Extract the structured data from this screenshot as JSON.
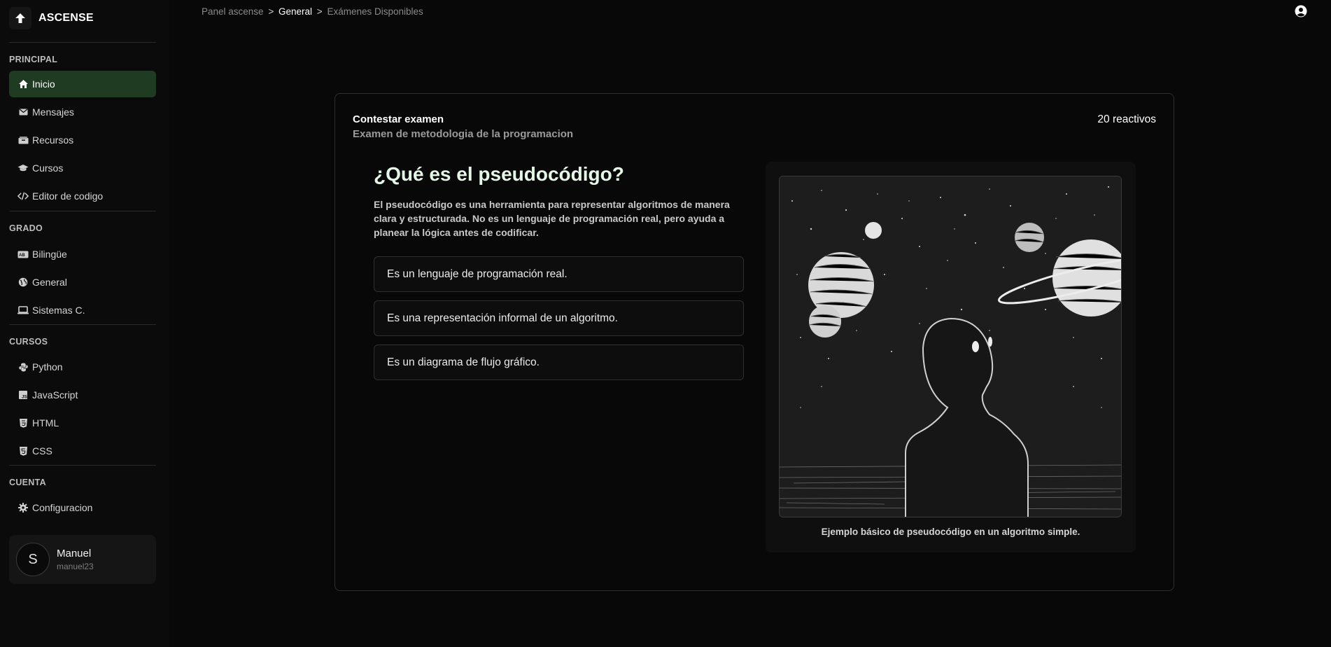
{
  "brand": {
    "name": "ASCENSE"
  },
  "sidebar": {
    "sections": {
      "principal": "PRINCIPAL",
      "grado": "GRADO",
      "cursos": "CURSOS",
      "cuenta": "CUENTA"
    },
    "principal_items": [
      {
        "label": "Inicio",
        "icon": "home-icon",
        "active": true
      },
      {
        "label": "Mensajes",
        "icon": "envelope-icon"
      },
      {
        "label": "Recursos",
        "icon": "box-icon"
      },
      {
        "label": "Cursos",
        "icon": "graduation-cap-icon"
      },
      {
        "label": "Editor de codigo",
        "icon": "code-icon"
      }
    ],
    "grado_items": [
      {
        "label": "Bilingüe",
        "icon": "id-card-icon"
      },
      {
        "label": "General",
        "icon": "globe-icon"
      },
      {
        "label": "Sistemas C.",
        "icon": "laptop-icon"
      }
    ],
    "cursos_items": [
      {
        "label": "Python",
        "icon": "python-icon"
      },
      {
        "label": "JavaScript",
        "icon": "javascript-icon"
      },
      {
        "label": "HTML",
        "icon": "html5-icon"
      },
      {
        "label": "CSS",
        "icon": "css3-icon"
      }
    ],
    "cuenta_items": [
      {
        "label": "Configuracion",
        "icon": "gear-icon"
      }
    ],
    "user": {
      "initial": "S",
      "name": "Manuel",
      "handle": "manuel23"
    }
  },
  "breadcrumb": {
    "root": "Panel ascense",
    "sep": ">",
    "current": "General",
    "last": "Exámenes Disponibles"
  },
  "exam": {
    "label": "Contestar examen",
    "name": "Examen de metodologia de la programacion",
    "count": "20 reactivos",
    "question": {
      "title": "¿Qué es el pseudocódigo?",
      "description": "El pseudocódigo es una herramienta para representar algoritmos de manera clara y estructurada. No es un lenguaje de programación real, pero ayuda a planear la lógica antes de codificar.",
      "options": [
        "Es un lenguaje de programación real.",
        "Es una representación informal de un algoritmo.",
        "Es un diagrama de flujo gráfico."
      ]
    },
    "figure": {
      "caption": "Ejemplo básico de pseudocódigo en un algoritmo simple."
    }
  },
  "colors": {
    "active_nav": "#1f3b22",
    "background": "#080808",
    "title_accent": "#e4f7e6"
  }
}
